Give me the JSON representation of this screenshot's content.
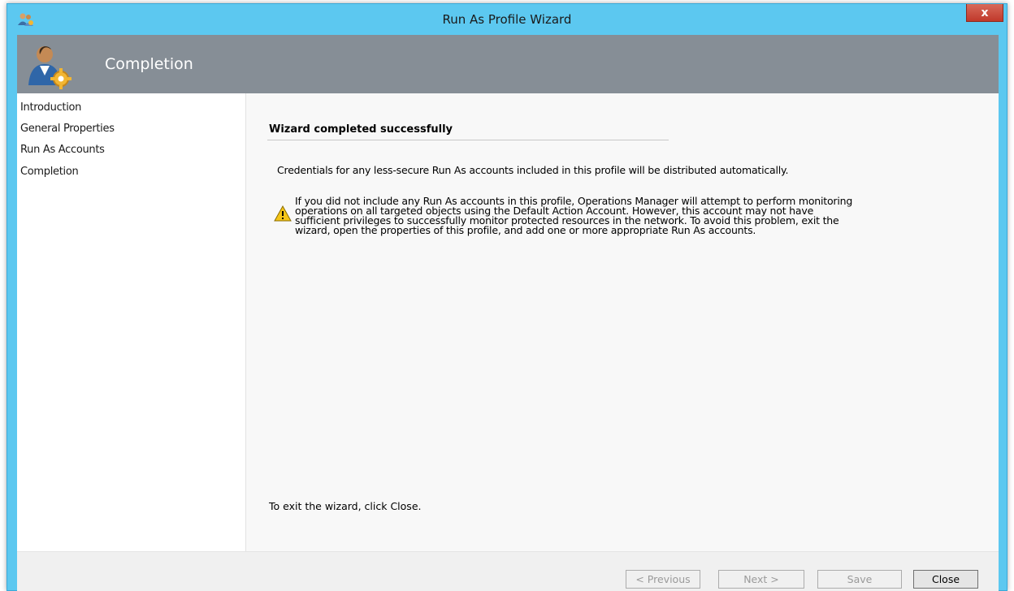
{
  "window": {
    "title": "Run As Profile Wizard",
    "close_glyph": "x"
  },
  "header": {
    "title": "Completion"
  },
  "nav": {
    "items": [
      {
        "label": "Introduction"
      },
      {
        "label": "General Properties"
      },
      {
        "label": "Run As Accounts"
      },
      {
        "label": "Completion"
      }
    ]
  },
  "content": {
    "section_title": "Wizard completed successfully",
    "credentials_text": "Credentials for any less-secure Run As accounts included in this profile will be distributed automatically.",
    "warning_lines": [
      "If you did not include any Run As accounts in this profile, Operations Manager will attempt to perform monitoring",
      "operations on all targeted objects using the Default Action Account. However, this account may not have",
      "sufficient privileges to successfully monitor protected resources in the network. To avoid this problem, exit the",
      "wizard, open the properties of this profile, and add one or more appropriate Run As accounts."
    ],
    "exit_text": "To exit the wizard, click Close."
  },
  "footer": {
    "previous_label": "< Previous",
    "next_label": "Next >",
    "save_label": "Save",
    "close_label": "Close"
  },
  "colors": {
    "window_frame": "#5cc8f0",
    "header_band": "#868e96",
    "close_button": "#c0392b",
    "warning_icon": "#f5c518"
  },
  "icons": {
    "app": "run-as-users-icon",
    "header": "user-gear-icon",
    "warning": "warning-icon",
    "close": "close-icon"
  }
}
